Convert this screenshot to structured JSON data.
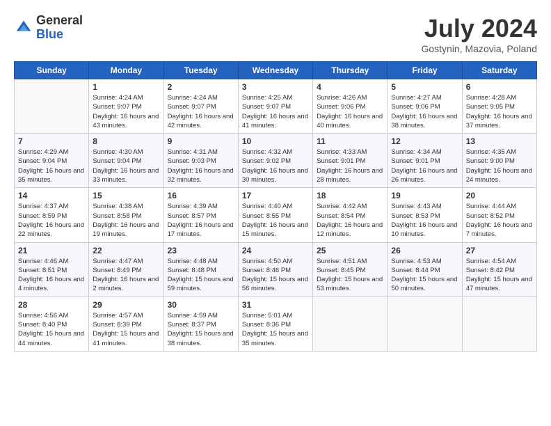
{
  "logo": {
    "general": "General",
    "blue": "Blue"
  },
  "title": {
    "month_year": "July 2024",
    "location": "Gostynin, Mazovia, Poland"
  },
  "headers": [
    "Sunday",
    "Monday",
    "Tuesday",
    "Wednesday",
    "Thursday",
    "Friday",
    "Saturday"
  ],
  "weeks": [
    [
      {
        "day": "",
        "sunrise": "",
        "sunset": "",
        "daylight": ""
      },
      {
        "day": "1",
        "sunrise": "Sunrise: 4:24 AM",
        "sunset": "Sunset: 9:07 PM",
        "daylight": "Daylight: 16 hours and 43 minutes."
      },
      {
        "day": "2",
        "sunrise": "Sunrise: 4:24 AM",
        "sunset": "Sunset: 9:07 PM",
        "daylight": "Daylight: 16 hours and 42 minutes."
      },
      {
        "day": "3",
        "sunrise": "Sunrise: 4:25 AM",
        "sunset": "Sunset: 9:07 PM",
        "daylight": "Daylight: 16 hours and 41 minutes."
      },
      {
        "day": "4",
        "sunrise": "Sunrise: 4:26 AM",
        "sunset": "Sunset: 9:06 PM",
        "daylight": "Daylight: 16 hours and 40 minutes."
      },
      {
        "day": "5",
        "sunrise": "Sunrise: 4:27 AM",
        "sunset": "Sunset: 9:06 PM",
        "daylight": "Daylight: 16 hours and 38 minutes."
      },
      {
        "day": "6",
        "sunrise": "Sunrise: 4:28 AM",
        "sunset": "Sunset: 9:05 PM",
        "daylight": "Daylight: 16 hours and 37 minutes."
      }
    ],
    [
      {
        "day": "7",
        "sunrise": "Sunrise: 4:29 AM",
        "sunset": "Sunset: 9:04 PM",
        "daylight": "Daylight: 16 hours and 35 minutes."
      },
      {
        "day": "8",
        "sunrise": "Sunrise: 4:30 AM",
        "sunset": "Sunset: 9:04 PM",
        "daylight": "Daylight: 16 hours and 33 minutes."
      },
      {
        "day": "9",
        "sunrise": "Sunrise: 4:31 AM",
        "sunset": "Sunset: 9:03 PM",
        "daylight": "Daylight: 16 hours and 32 minutes."
      },
      {
        "day": "10",
        "sunrise": "Sunrise: 4:32 AM",
        "sunset": "Sunset: 9:02 PM",
        "daylight": "Daylight: 16 hours and 30 minutes."
      },
      {
        "day": "11",
        "sunrise": "Sunrise: 4:33 AM",
        "sunset": "Sunset: 9:01 PM",
        "daylight": "Daylight: 16 hours and 28 minutes."
      },
      {
        "day": "12",
        "sunrise": "Sunrise: 4:34 AM",
        "sunset": "Sunset: 9:01 PM",
        "daylight": "Daylight: 16 hours and 26 minutes."
      },
      {
        "day": "13",
        "sunrise": "Sunrise: 4:35 AM",
        "sunset": "Sunset: 9:00 PM",
        "daylight": "Daylight: 16 hours and 24 minutes."
      }
    ],
    [
      {
        "day": "14",
        "sunrise": "Sunrise: 4:37 AM",
        "sunset": "Sunset: 8:59 PM",
        "daylight": "Daylight: 16 hours and 22 minutes."
      },
      {
        "day": "15",
        "sunrise": "Sunrise: 4:38 AM",
        "sunset": "Sunset: 8:58 PM",
        "daylight": "Daylight: 16 hours and 19 minutes."
      },
      {
        "day": "16",
        "sunrise": "Sunrise: 4:39 AM",
        "sunset": "Sunset: 8:57 PM",
        "daylight": "Daylight: 16 hours and 17 minutes."
      },
      {
        "day": "17",
        "sunrise": "Sunrise: 4:40 AM",
        "sunset": "Sunset: 8:55 PM",
        "daylight": "Daylight: 16 hours and 15 minutes."
      },
      {
        "day": "18",
        "sunrise": "Sunrise: 4:42 AM",
        "sunset": "Sunset: 8:54 PM",
        "daylight": "Daylight: 16 hours and 12 minutes."
      },
      {
        "day": "19",
        "sunrise": "Sunrise: 4:43 AM",
        "sunset": "Sunset: 8:53 PM",
        "daylight": "Daylight: 16 hours and 10 minutes."
      },
      {
        "day": "20",
        "sunrise": "Sunrise: 4:44 AM",
        "sunset": "Sunset: 8:52 PM",
        "daylight": "Daylight: 16 hours and 7 minutes."
      }
    ],
    [
      {
        "day": "21",
        "sunrise": "Sunrise: 4:46 AM",
        "sunset": "Sunset: 8:51 PM",
        "daylight": "Daylight: 16 hours and 4 minutes."
      },
      {
        "day": "22",
        "sunrise": "Sunrise: 4:47 AM",
        "sunset": "Sunset: 8:49 PM",
        "daylight": "Daylight: 16 hours and 2 minutes."
      },
      {
        "day": "23",
        "sunrise": "Sunrise: 4:48 AM",
        "sunset": "Sunset: 8:48 PM",
        "daylight": "Daylight: 15 hours and 59 minutes."
      },
      {
        "day": "24",
        "sunrise": "Sunrise: 4:50 AM",
        "sunset": "Sunset: 8:46 PM",
        "daylight": "Daylight: 15 hours and 56 minutes."
      },
      {
        "day": "25",
        "sunrise": "Sunrise: 4:51 AM",
        "sunset": "Sunset: 8:45 PM",
        "daylight": "Daylight: 15 hours and 53 minutes."
      },
      {
        "day": "26",
        "sunrise": "Sunrise: 4:53 AM",
        "sunset": "Sunset: 8:44 PM",
        "daylight": "Daylight: 15 hours and 50 minutes."
      },
      {
        "day": "27",
        "sunrise": "Sunrise: 4:54 AM",
        "sunset": "Sunset: 8:42 PM",
        "daylight": "Daylight: 15 hours and 47 minutes."
      }
    ],
    [
      {
        "day": "28",
        "sunrise": "Sunrise: 4:56 AM",
        "sunset": "Sunset: 8:40 PM",
        "daylight": "Daylight: 15 hours and 44 minutes."
      },
      {
        "day": "29",
        "sunrise": "Sunrise: 4:57 AM",
        "sunset": "Sunset: 8:39 PM",
        "daylight": "Daylight: 15 hours and 41 minutes."
      },
      {
        "day": "30",
        "sunrise": "Sunrise: 4:59 AM",
        "sunset": "Sunset: 8:37 PM",
        "daylight": "Daylight: 15 hours and 38 minutes."
      },
      {
        "day": "31",
        "sunrise": "Sunrise: 5:01 AM",
        "sunset": "Sunset: 8:36 PM",
        "daylight": "Daylight: 15 hours and 35 minutes."
      },
      {
        "day": "",
        "sunrise": "",
        "sunset": "",
        "daylight": ""
      },
      {
        "day": "",
        "sunrise": "",
        "sunset": "",
        "daylight": ""
      },
      {
        "day": "",
        "sunrise": "",
        "sunset": "",
        "daylight": ""
      }
    ]
  ]
}
